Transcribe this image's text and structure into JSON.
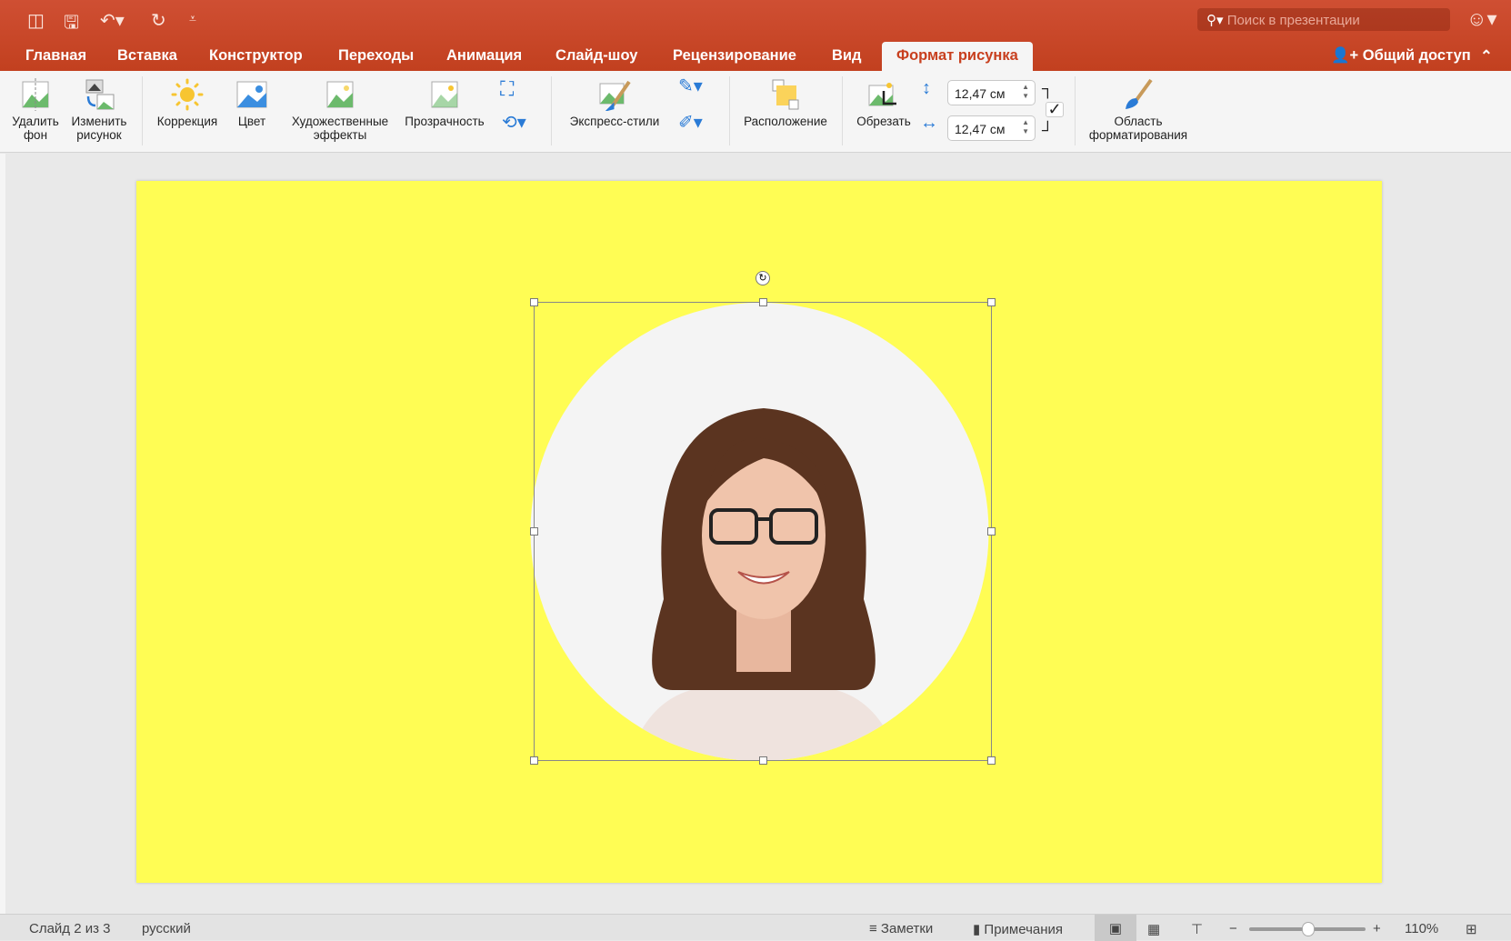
{
  "quick_access": {
    "sidebar_icon": "sidebar-icon",
    "save_icon": "save-icon",
    "undo_icon": "undo-icon",
    "redo_icon": "redo-icon",
    "customize_icon": "customize-icon"
  },
  "search": {
    "placeholder": "Поиск в презентации"
  },
  "tabs": [
    "Главная",
    "Вставка",
    "Конструктор",
    "Переходы",
    "Анимация",
    "Слайд-шоу",
    "Рецензирование",
    "Вид",
    "Формат рисунка"
  ],
  "active_tab": "Формат рисунка",
  "share_label": "Общий доступ",
  "ribbon": {
    "remove_bg": [
      "Удалить",
      "фон"
    ],
    "change_picture": [
      "Изменить",
      "рисунок"
    ],
    "corrections": "Коррекция",
    "color": "Цвет",
    "artistic": [
      "Художественные",
      "эффекты"
    ],
    "transparency": "Прозрачность",
    "quick_styles": "Экспресс-стили",
    "arrange": "Расположение",
    "crop": "Обрезать",
    "height": "12,47 см",
    "width": "12,47 см",
    "format_pane": [
      "Область",
      "форматирования"
    ]
  },
  "status": {
    "slide": "Слайд 2 из 3",
    "language": "русский",
    "notes": "Заметки",
    "comments": "Примечания",
    "zoom": "110%",
    "zoom_level": 110
  },
  "colors": {
    "accent": "#c8401f",
    "slide_bg": "#fffd54"
  }
}
